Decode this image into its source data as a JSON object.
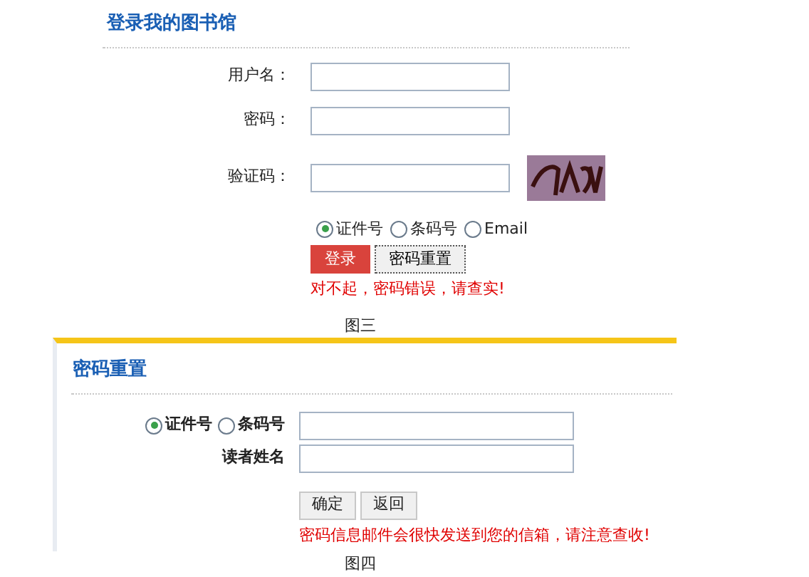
{
  "login": {
    "title": "登录我的图书馆",
    "fields": [
      {
        "label": "用户名："
      },
      {
        "label": "密码："
      },
      {
        "label": "验证码："
      }
    ],
    "login_types": [
      {
        "label": "证件号",
        "selected": true
      },
      {
        "label": "条码号",
        "selected": false
      },
      {
        "label": "Email",
        "selected": false
      }
    ],
    "buttons": [
      {
        "label": "登录",
        "kind": "primary"
      },
      {
        "label": "密码重置",
        "kind": "secondary"
      }
    ],
    "error": "对不起，密码错误，请查实!"
  },
  "caption_1": "图三",
  "reset": {
    "title": "密码重置",
    "id_types": [
      {
        "label": "证件号",
        "selected": true
      },
      {
        "label": "条码号",
        "selected": false
      }
    ],
    "name_label": "读者姓名",
    "buttons": [
      {
        "label": "确定"
      },
      {
        "label": "返回"
      }
    ],
    "message": "密码信息邮件会很快发送到您的信箱，请注意查收!"
  },
  "caption_2": "图四"
}
